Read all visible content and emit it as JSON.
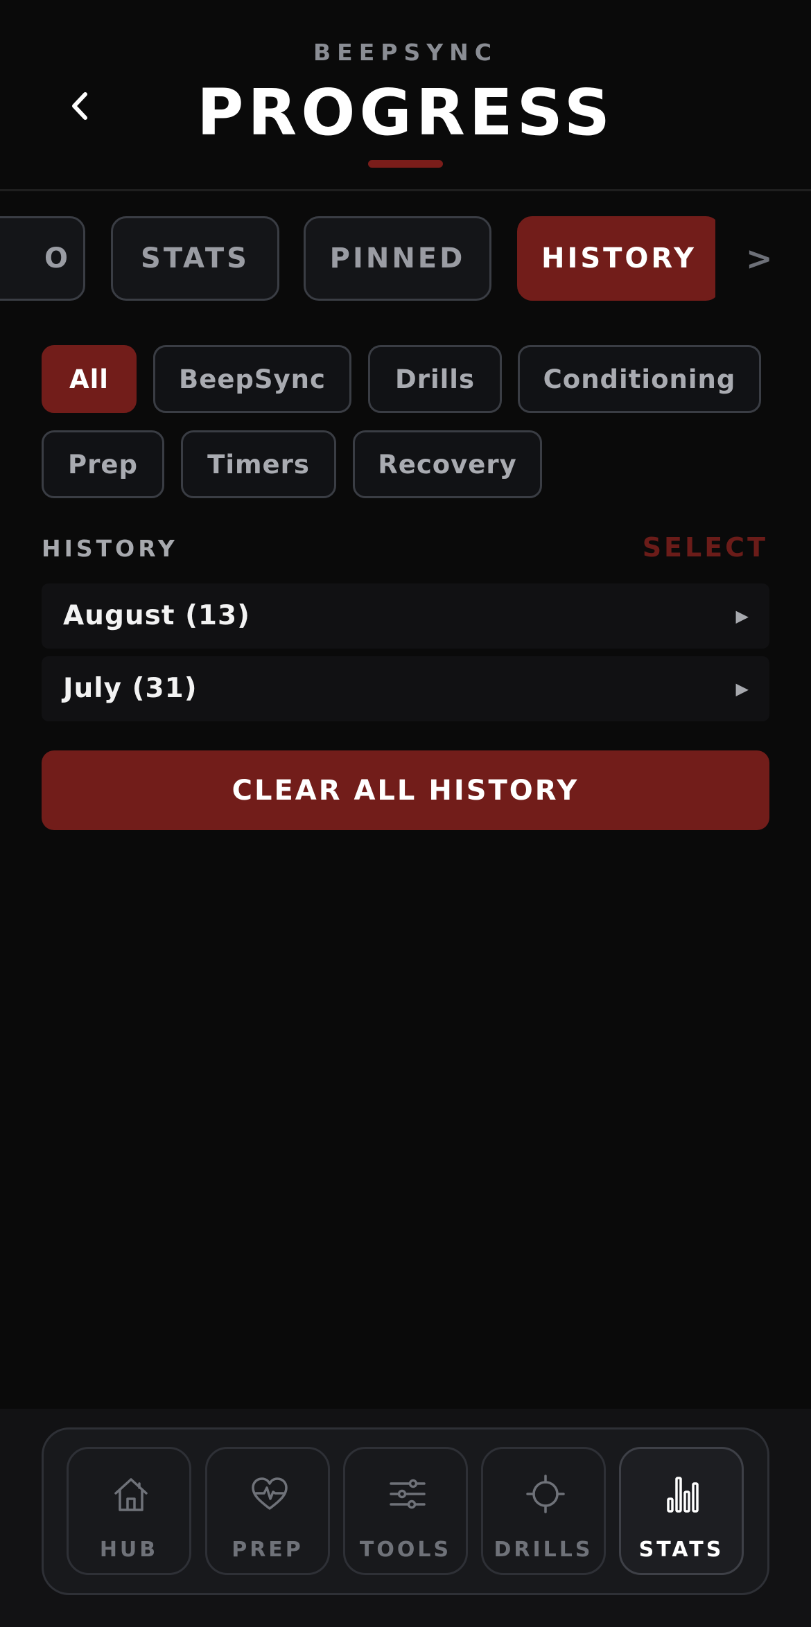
{
  "header": {
    "app_name": "BEEPSYNC",
    "title": "PROGRESS",
    "back_icon": "chevron-left-icon"
  },
  "tabs": [
    {
      "label": "O",
      "active": false
    },
    {
      "label": "STATS",
      "active": false
    },
    {
      "label": "PINNED",
      "active": false
    },
    {
      "label": "HISTORY",
      "active": true
    }
  ],
  "tabs_next_label": ">",
  "filters": [
    {
      "label": "All",
      "active": true
    },
    {
      "label": "BeepSync",
      "active": false
    },
    {
      "label": "Drills",
      "active": false
    },
    {
      "label": "Conditioning",
      "active": false
    },
    {
      "label": "Prep",
      "active": false
    },
    {
      "label": "Timers",
      "active": false
    },
    {
      "label": "Recovery",
      "active": false
    }
  ],
  "history": {
    "section_label": "HISTORY",
    "select_label": "SELECT",
    "months": [
      {
        "label": "August (13)",
        "arrow": "▶"
      },
      {
        "label": "July (31)",
        "arrow": "▶"
      }
    ],
    "clear_label": "CLEAR ALL HISTORY"
  },
  "nav": {
    "items": [
      {
        "label": "HUB",
        "icon": "home-icon",
        "active": false
      },
      {
        "label": "PREP",
        "icon": "heart-pulse-icon",
        "active": false
      },
      {
        "label": "TOOLS",
        "icon": "sliders-icon",
        "active": false
      },
      {
        "label": "DRILLS",
        "icon": "crosshair-icon",
        "active": false
      },
      {
        "label": "STATS",
        "icon": "bar-chart-icon",
        "active": true
      }
    ]
  },
  "colors": {
    "background": "#0a0a0a",
    "accent": "#721d1a",
    "select_text": "#6b1c19",
    "muted_text": "#a7a9ae"
  }
}
